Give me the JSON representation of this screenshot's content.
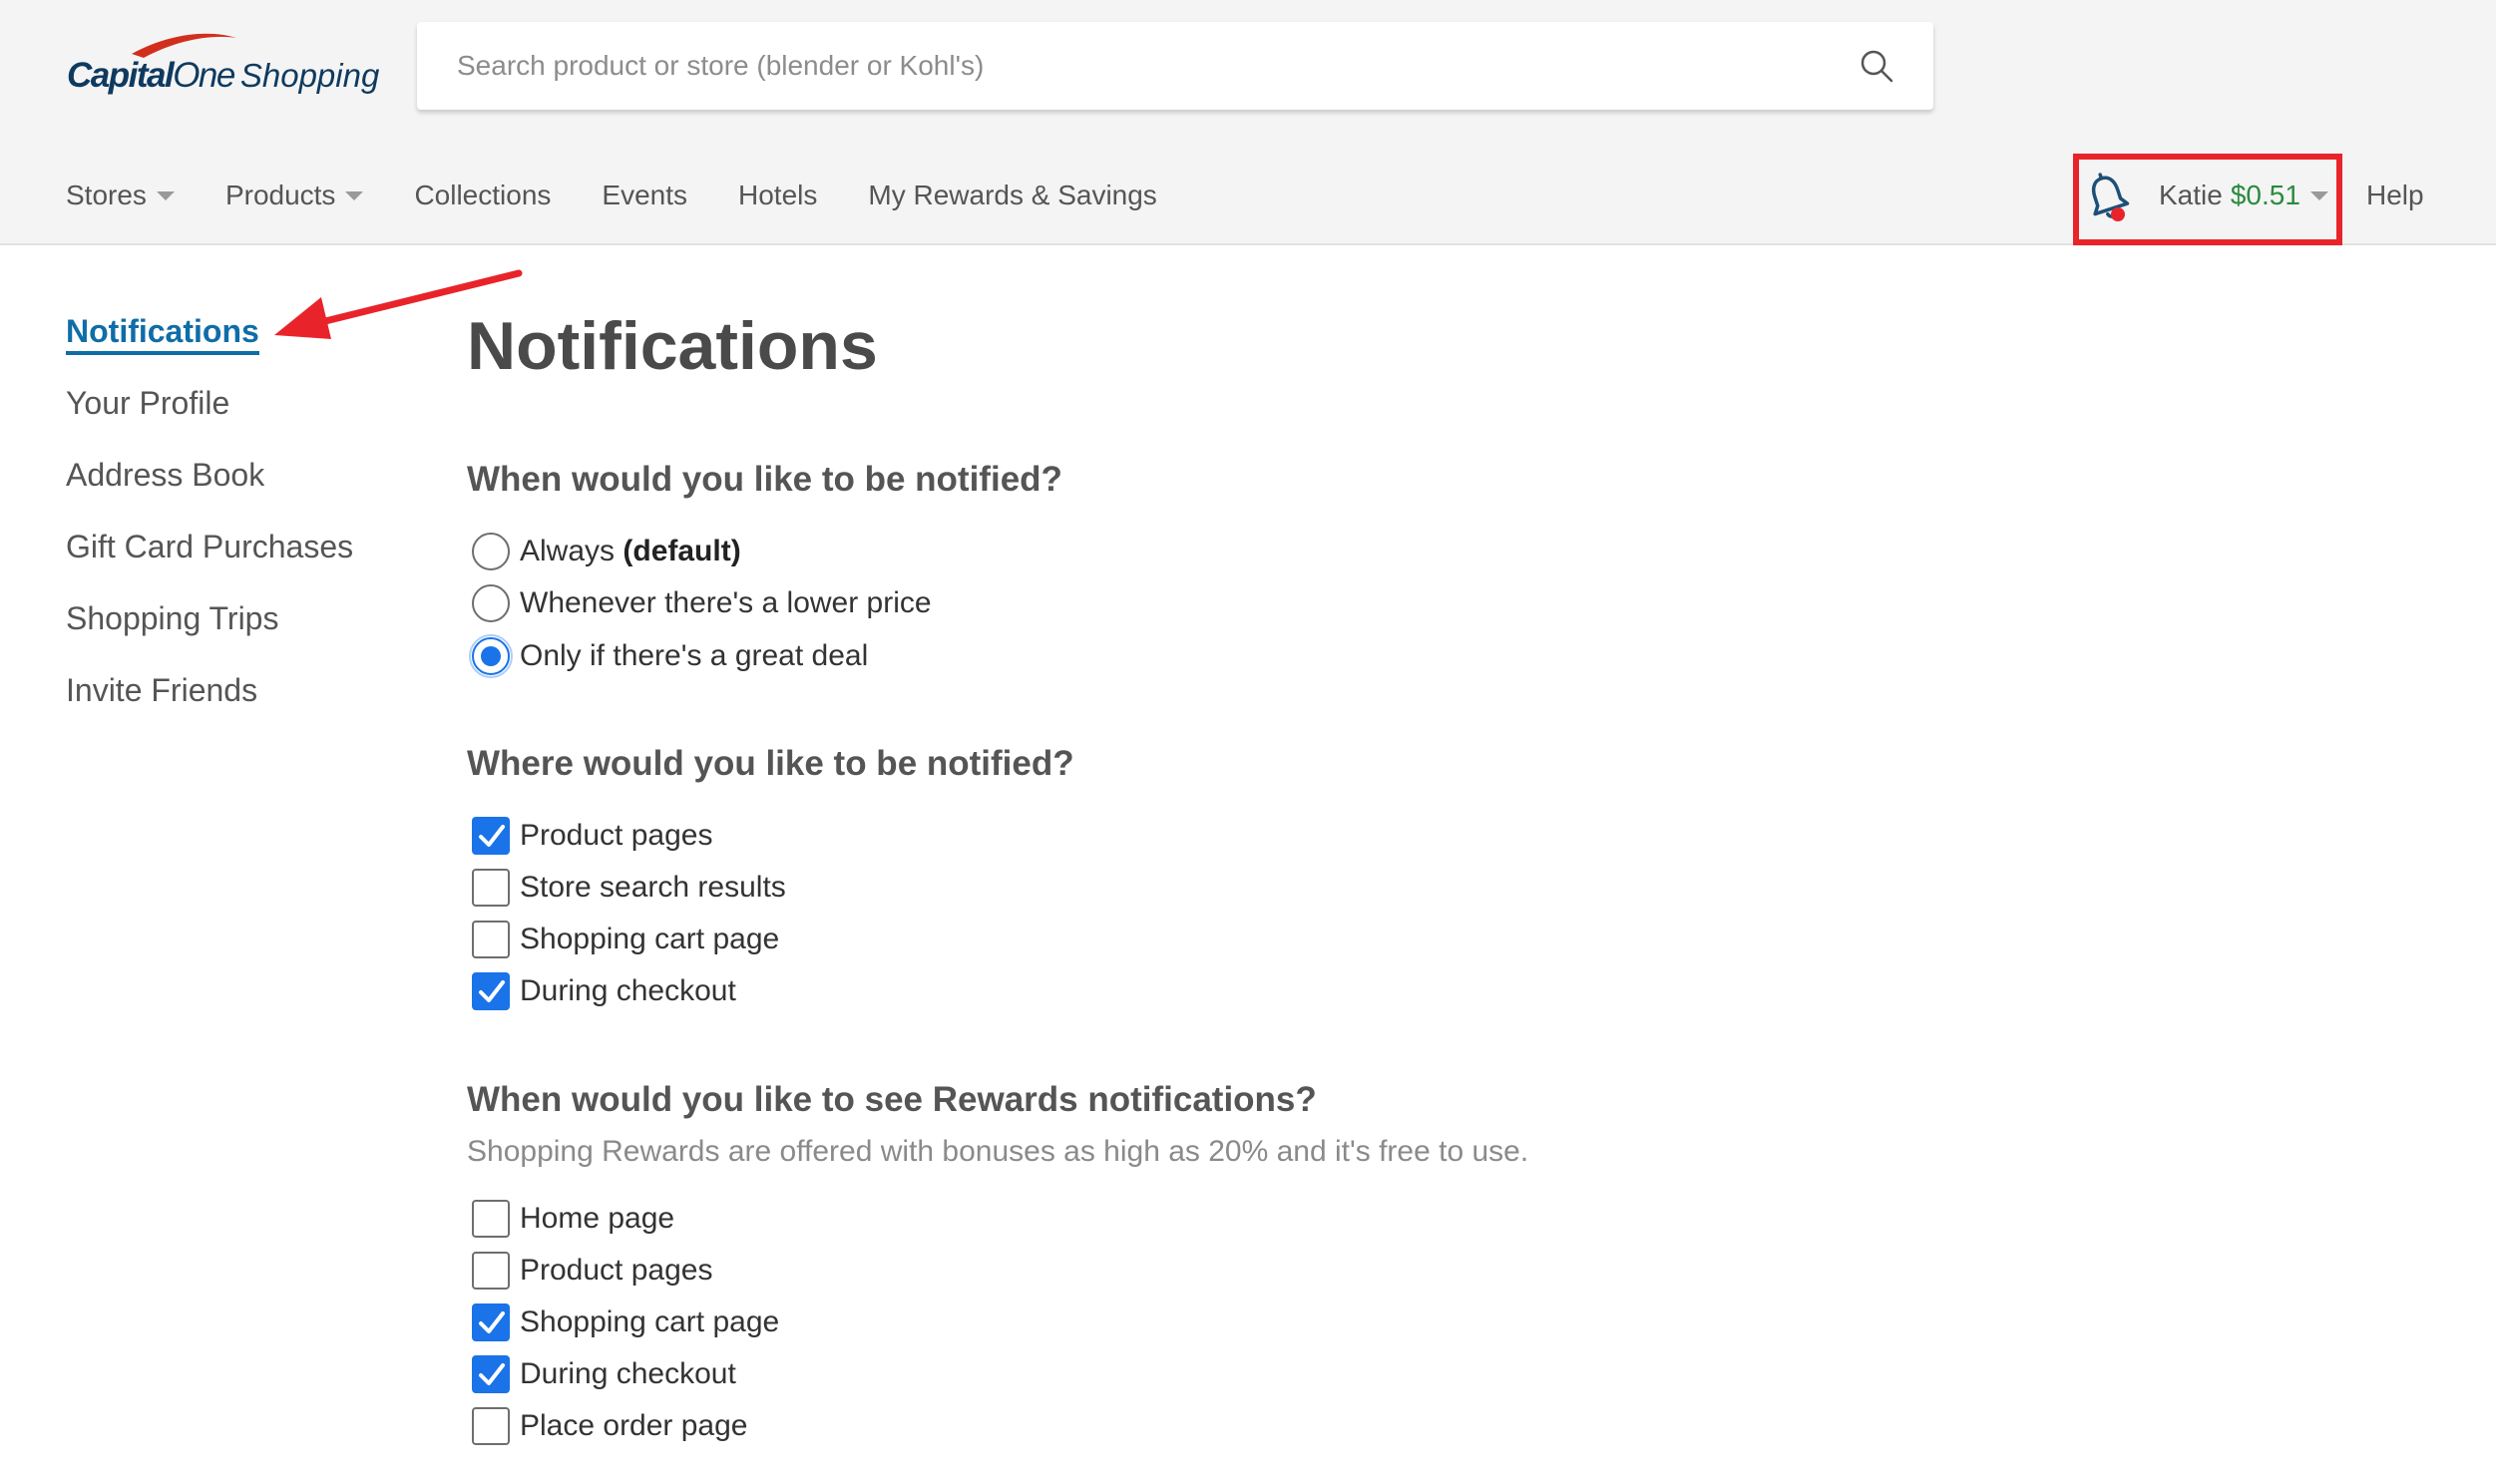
{
  "brand": {
    "capital": "Capital",
    "one": "One",
    "shopping": "Shopping"
  },
  "search": {
    "placeholder": "Search product or store (blender or Kohl's)",
    "icon": "search-icon"
  },
  "nav": {
    "items": [
      {
        "label": "Stores",
        "dropdown": true
      },
      {
        "label": "Products",
        "dropdown": true
      },
      {
        "label": "Collections",
        "dropdown": false
      },
      {
        "label": "Events",
        "dropdown": false
      },
      {
        "label": "Hotels",
        "dropdown": false
      },
      {
        "label": "My Rewards & Savings",
        "dropdown": false
      }
    ]
  },
  "account": {
    "name": "Katie",
    "balance": "$0.51",
    "help": "Help",
    "bell_icon": "bell-icon",
    "has_notification_dot": true
  },
  "sidebar": {
    "items": [
      {
        "label": "Notifications",
        "active": true
      },
      {
        "label": "Your Profile",
        "active": false
      },
      {
        "label": "Address Book",
        "active": false
      },
      {
        "label": "Gift Card Purchases",
        "active": false
      },
      {
        "label": "Shopping Trips",
        "active": false
      },
      {
        "label": "Invite Friends",
        "active": false
      }
    ]
  },
  "page": {
    "title": "Notifications",
    "when": {
      "title": "When would you like to be notified?",
      "options": [
        {
          "label": "Always",
          "suffix": "(default)",
          "selected": false
        },
        {
          "label": "Whenever there's a lower price",
          "suffix": "",
          "selected": false
        },
        {
          "label": "Only if there's a great deal",
          "suffix": "",
          "selected": true
        }
      ]
    },
    "where": {
      "title": "Where would you like to be notified?",
      "options": [
        {
          "label": "Product pages",
          "checked": true
        },
        {
          "label": "Store search results",
          "checked": false
        },
        {
          "label": "Shopping cart page",
          "checked": false
        },
        {
          "label": "During checkout",
          "checked": true
        }
      ]
    },
    "rewards": {
      "title": "When would you like to see Rewards notifications?",
      "subtitle": "Shopping Rewards are offered with bonuses as high as 20% and it's free to use.",
      "options": [
        {
          "label": "Home page",
          "checked": false
        },
        {
          "label": "Product pages",
          "checked": false
        },
        {
          "label": "Shopping cart page",
          "checked": true
        },
        {
          "label": "During checkout",
          "checked": true
        },
        {
          "label": "Place order page",
          "checked": false
        }
      ]
    }
  },
  "colors": {
    "accent": "#1a73e8",
    "link": "#0f6da7",
    "highlight": "#e8242a",
    "balance": "#2b8a3e",
    "notification_dot": "#e8242a"
  }
}
